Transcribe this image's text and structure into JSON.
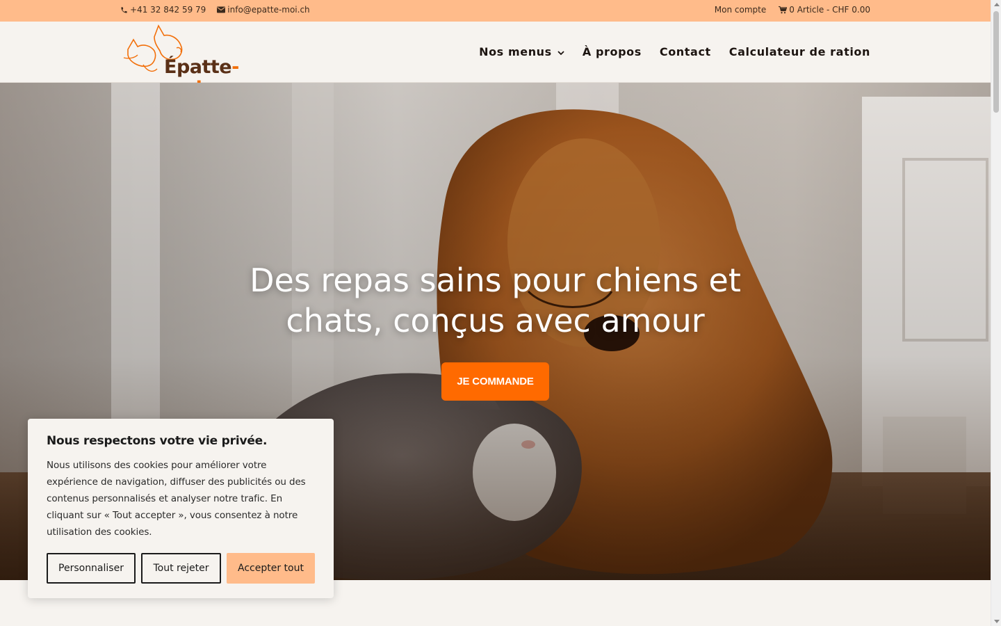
{
  "topbar": {
    "phone": "+41 32 842 59 79",
    "email": "info@epatte-moi.ch",
    "account_label": "Mon compte",
    "cart_label": "0 Article - CHF 0.00",
    "background": "#ffbb8a"
  },
  "header": {
    "logo_text_main": "Épatte",
    "logo_text_accent": "-moi",
    "nav": [
      {
        "label": "Nos menus",
        "has_dropdown": true
      },
      {
        "label": "À propos"
      },
      {
        "label": "Contact"
      },
      {
        "label": "Calculateur de ration"
      }
    ]
  },
  "hero": {
    "title": "Des repas sains pour chiens et chats, conçus avec amour",
    "cta_label": "JE COMMANDE",
    "cta_color": "#ff6a00"
  },
  "cookie_banner": {
    "title": "Nous respectons votre vie privée.",
    "body": "Nous utilisons des cookies pour améliorer votre expérience de navigation, diffuser des publicités ou des contenus personnalisés et analyser notre trafic. En cliquant sur « Tout accepter », vous consentez à notre utilisation des cookies.",
    "customize_label": "Personnaliser",
    "reject_label": "Tout rejeter",
    "accept_label": "Accepter tout"
  },
  "icons": {
    "phone": "phone-icon",
    "email": "envelope-icon",
    "cart": "cart-icon",
    "dropdown": "chevron-down-icon"
  }
}
